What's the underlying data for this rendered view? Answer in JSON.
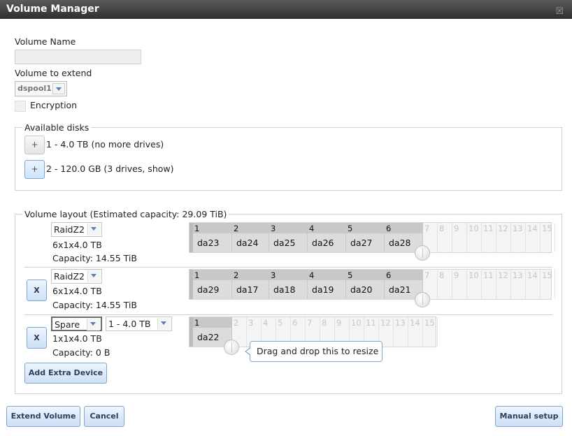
{
  "window": {
    "title": "Volume Manager",
    "close_glyph": "☒"
  },
  "form": {
    "volume_name_label": "Volume Name",
    "volume_name_value": "",
    "volume_to_extend_label": "Volume to extend",
    "volume_to_extend_value": "dspool1",
    "encryption_label": "Encryption"
  },
  "available_disks": {
    "legend": "Available disks",
    "groups": [
      {
        "button": "+",
        "text": "1 - 4.0 TB (no more drives)"
      },
      {
        "button": "+",
        "text": "2 - 120.0 GB (3 drives, show)"
      }
    ]
  },
  "layout": {
    "legend": "Volume layout (Estimated capacity: 29.09 TiB)",
    "rows": [
      {
        "type": "RaidZ2",
        "disk_info": "6x1x4.0 TB",
        "capacity": "Capacity: 14.55 TiB",
        "slots": [
          "1",
          "2",
          "3",
          "4",
          "5",
          "6",
          "7",
          "8",
          "9",
          "10",
          "11",
          "12",
          "13",
          "14",
          "15"
        ],
        "disks": [
          "da23",
          "da24",
          "da25",
          "da26",
          "da27",
          "da28"
        ]
      },
      {
        "remove_label": "X",
        "type": "RaidZ2",
        "disk_info": "6x1x4.0 TB",
        "capacity": "Capacity: 14.55 TiB",
        "slots": [
          "1",
          "2",
          "3",
          "4",
          "5",
          "6",
          "7",
          "8",
          "9",
          "10",
          "11",
          "12",
          "13",
          "14",
          "15"
        ],
        "disks": [
          "da29",
          "da17",
          "da18",
          "da19",
          "da20",
          "da21"
        ]
      },
      {
        "remove_label": "X",
        "type": "Spare",
        "size": "1 - 4.0 TB",
        "disk_info": "1x1x4.0 TB",
        "capacity": "Capacity: 0 B",
        "slots": [
          "1",
          "2",
          "3",
          "4",
          "5",
          "6",
          "7",
          "8",
          "9",
          "10",
          "11",
          "12",
          "13",
          "14",
          "15"
        ],
        "disks": [
          "da22"
        ]
      }
    ],
    "tooltip": "Drag and drop this to resize",
    "add_extra_device": "Add Extra Device"
  },
  "footer": {
    "extend_volume": "Extend Volume",
    "cancel": "Cancel",
    "manual_setup": "Manual setup"
  },
  "icons": {
    "dropdown": "chevron-down-icon",
    "resize": "resize-handle-icon"
  },
  "colors": {
    "title_bar": "#3f3f3f",
    "button_border": "#7fa6d3",
    "button_fill": "#cde0f6",
    "disk_on": "#dcdcdc"
  }
}
